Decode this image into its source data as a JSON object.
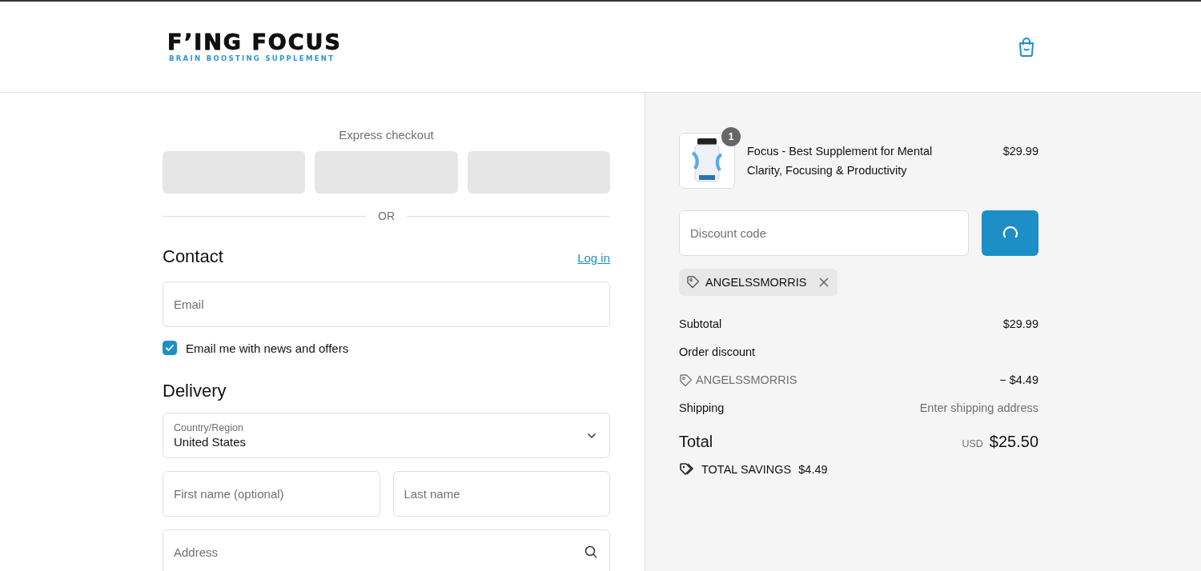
{
  "header": {
    "logo_title": "F’ING FOCUS",
    "logo_tagline": "BRAIN BOOSTING SUPPLEMENT"
  },
  "express_checkout": {
    "title": "Express checkout",
    "divider": "OR"
  },
  "contact": {
    "heading": "Contact",
    "login_link": "Log in",
    "email": {
      "placeholder": "Email"
    },
    "newsletter": {
      "label": "Email me with news and offers",
      "checked": true
    }
  },
  "delivery": {
    "heading": "Delivery",
    "rows": [
      [
        {
          "kind": "select",
          "label": "Country/Region",
          "value": "United States"
        }
      ],
      [
        {
          "kind": "text",
          "placeholder": "First name (optional)"
        },
        {
          "kind": "text",
          "placeholder": "Last name"
        }
      ],
      [
        {
          "kind": "search",
          "placeholder": "Address"
        }
      ]
    ]
  },
  "summary": {
    "items": [
      {
        "quantity": "1",
        "title": "Focus - Best Supplement for Mental Clarity, Focusing & Productivity",
        "price": "$29.99"
      }
    ],
    "discount": {
      "placeholder": "Discount code",
      "loading": true
    },
    "applied_codes": [
      {
        "code": "ANGELSSMORRIS"
      }
    ],
    "lines": [
      {
        "kind": "plain",
        "label": "Subtotal",
        "value": "$29.99"
      },
      {
        "kind": "heading",
        "label": "Order discount"
      },
      {
        "kind": "code",
        "label": "ANGELSSMORRIS",
        "value": "− $4.49"
      },
      {
        "kind": "muted",
        "label": "Shipping",
        "value": "Enter shipping address"
      }
    ],
    "total": {
      "label": "Total",
      "currency": "USD",
      "amount": "$25.50"
    },
    "savings": {
      "label": "TOTAL SAVINGS",
      "amount": "$4.49"
    }
  }
}
